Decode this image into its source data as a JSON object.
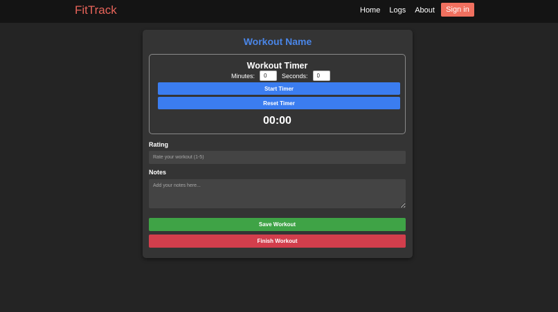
{
  "navbar": {
    "brand": "FitTrack",
    "links": [
      "Home",
      "Logs",
      "About"
    ],
    "signin_label": "Sign in"
  },
  "workout": {
    "title": "Workout Name"
  },
  "timer": {
    "title": "Workout Timer",
    "minutes_label": "Minutes:",
    "minutes_value": "0",
    "seconds_label": "Seconds:",
    "seconds_value": "0",
    "start_label": "Start Timer",
    "reset_label": "Reset Timer",
    "display": "00:00"
  },
  "rating": {
    "label": "Rating",
    "placeholder": "Rate your workout (1-5)"
  },
  "notes": {
    "label": "Notes",
    "placeholder": "Add your notes here..."
  },
  "actions": {
    "save_label": "Save Workout",
    "finish_label": "Finish Workout"
  },
  "colors": {
    "brand": "#e8645a",
    "signin": "#f0705f",
    "title": "#4a86e8",
    "primary": "#3b7df0",
    "success": "#3fa346",
    "danger": "#d23e4c"
  }
}
